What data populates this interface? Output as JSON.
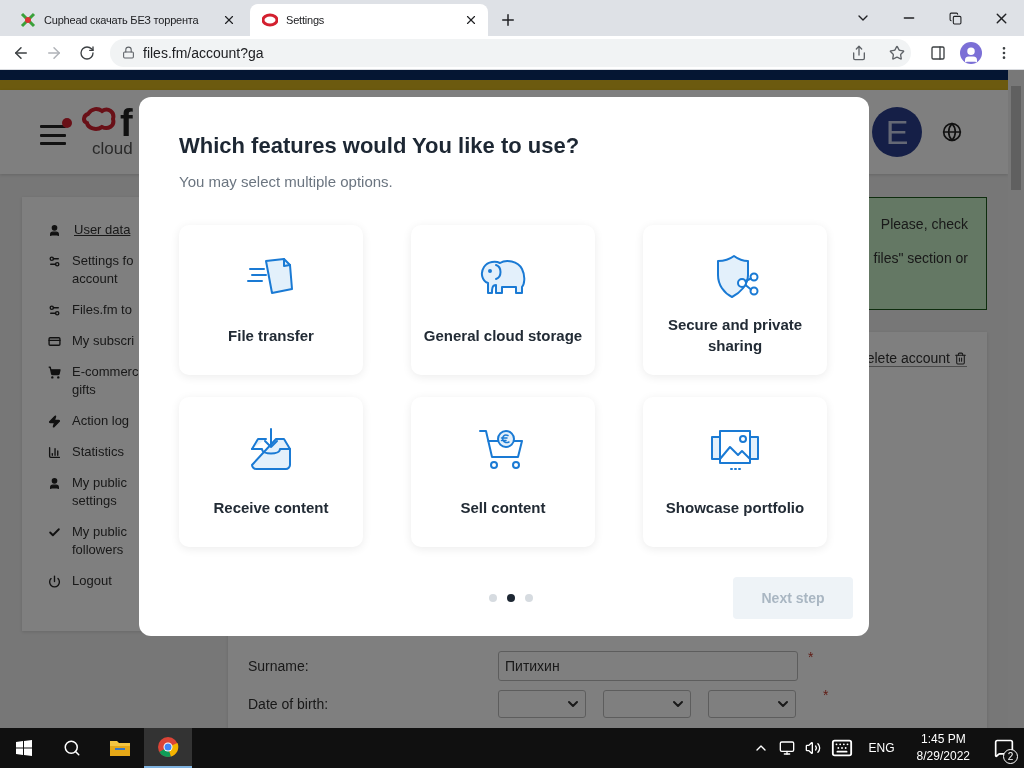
{
  "browser": {
    "tabs": [
      {
        "title": "Cuphead скачать БЕЗ торрента",
        "selected": false
      },
      {
        "title": "Settings",
        "selected": true
      }
    ],
    "address": "files.fm/account?ga"
  },
  "header": {
    "logo_letter": "f",
    "logo_tagline": "cloud",
    "avatar": "E"
  },
  "sidebar": {
    "items": [
      {
        "label": "User data",
        "kind": "user",
        "selected": true
      },
      {
        "label": "Settings fo\naccount",
        "kind": "cogs",
        "selected": false
      },
      {
        "label": "Files.fm to",
        "kind": "cogs",
        "selected": false
      },
      {
        "label": "My subscri",
        "kind": "card",
        "selected": false
      },
      {
        "label": "E-commerc\ngifts",
        "kind": "cart",
        "selected": false
      },
      {
        "label": "Action log",
        "kind": "bolt",
        "selected": false
      },
      {
        "label": "Statistics",
        "kind": "chart",
        "selected": false
      },
      {
        "label": "My public\nsettings",
        "kind": "user",
        "selected": false
      },
      {
        "label": "My public\nfollowers",
        "kind": "check",
        "selected": false
      },
      {
        "label": "Logout",
        "kind": "power",
        "selected": false
      }
    ]
  },
  "notice": {
    "lines": [
      "Please, check",
      "files\" section or"
    ]
  },
  "account": {
    "delete": "elete account",
    "fields": [
      {
        "label": "Surname:",
        "kind": "text",
        "value": "Питихин",
        "required_mark": "*"
      },
      {
        "label": "Date of birth:",
        "kind": "date",
        "required_mark": "*"
      }
    ]
  },
  "modal": {
    "title": "Which features would You like to use?",
    "subtitle": "You may select multiple options.",
    "options": [
      {
        "label": "File transfer",
        "kind": "transfer"
      },
      {
        "label": "General cloud storage",
        "kind": "storage"
      },
      {
        "label": "Secure and private sharing",
        "kind": "sharing"
      },
      {
        "label": "Receive content",
        "kind": "receive"
      },
      {
        "label": "Sell content",
        "kind": "sell"
      },
      {
        "label": "Showcase portfolio",
        "kind": "portfolio"
      }
    ],
    "pages": [
      {
        "selected": false
      },
      {
        "selected": true
      },
      {
        "selected": false
      }
    ],
    "next_button": {
      "label": "Next step",
      "disabled": true
    }
  },
  "taskbar": {
    "language": "ENG",
    "time": "1:45 PM",
    "date": "8/29/2022",
    "notifications": "2"
  }
}
